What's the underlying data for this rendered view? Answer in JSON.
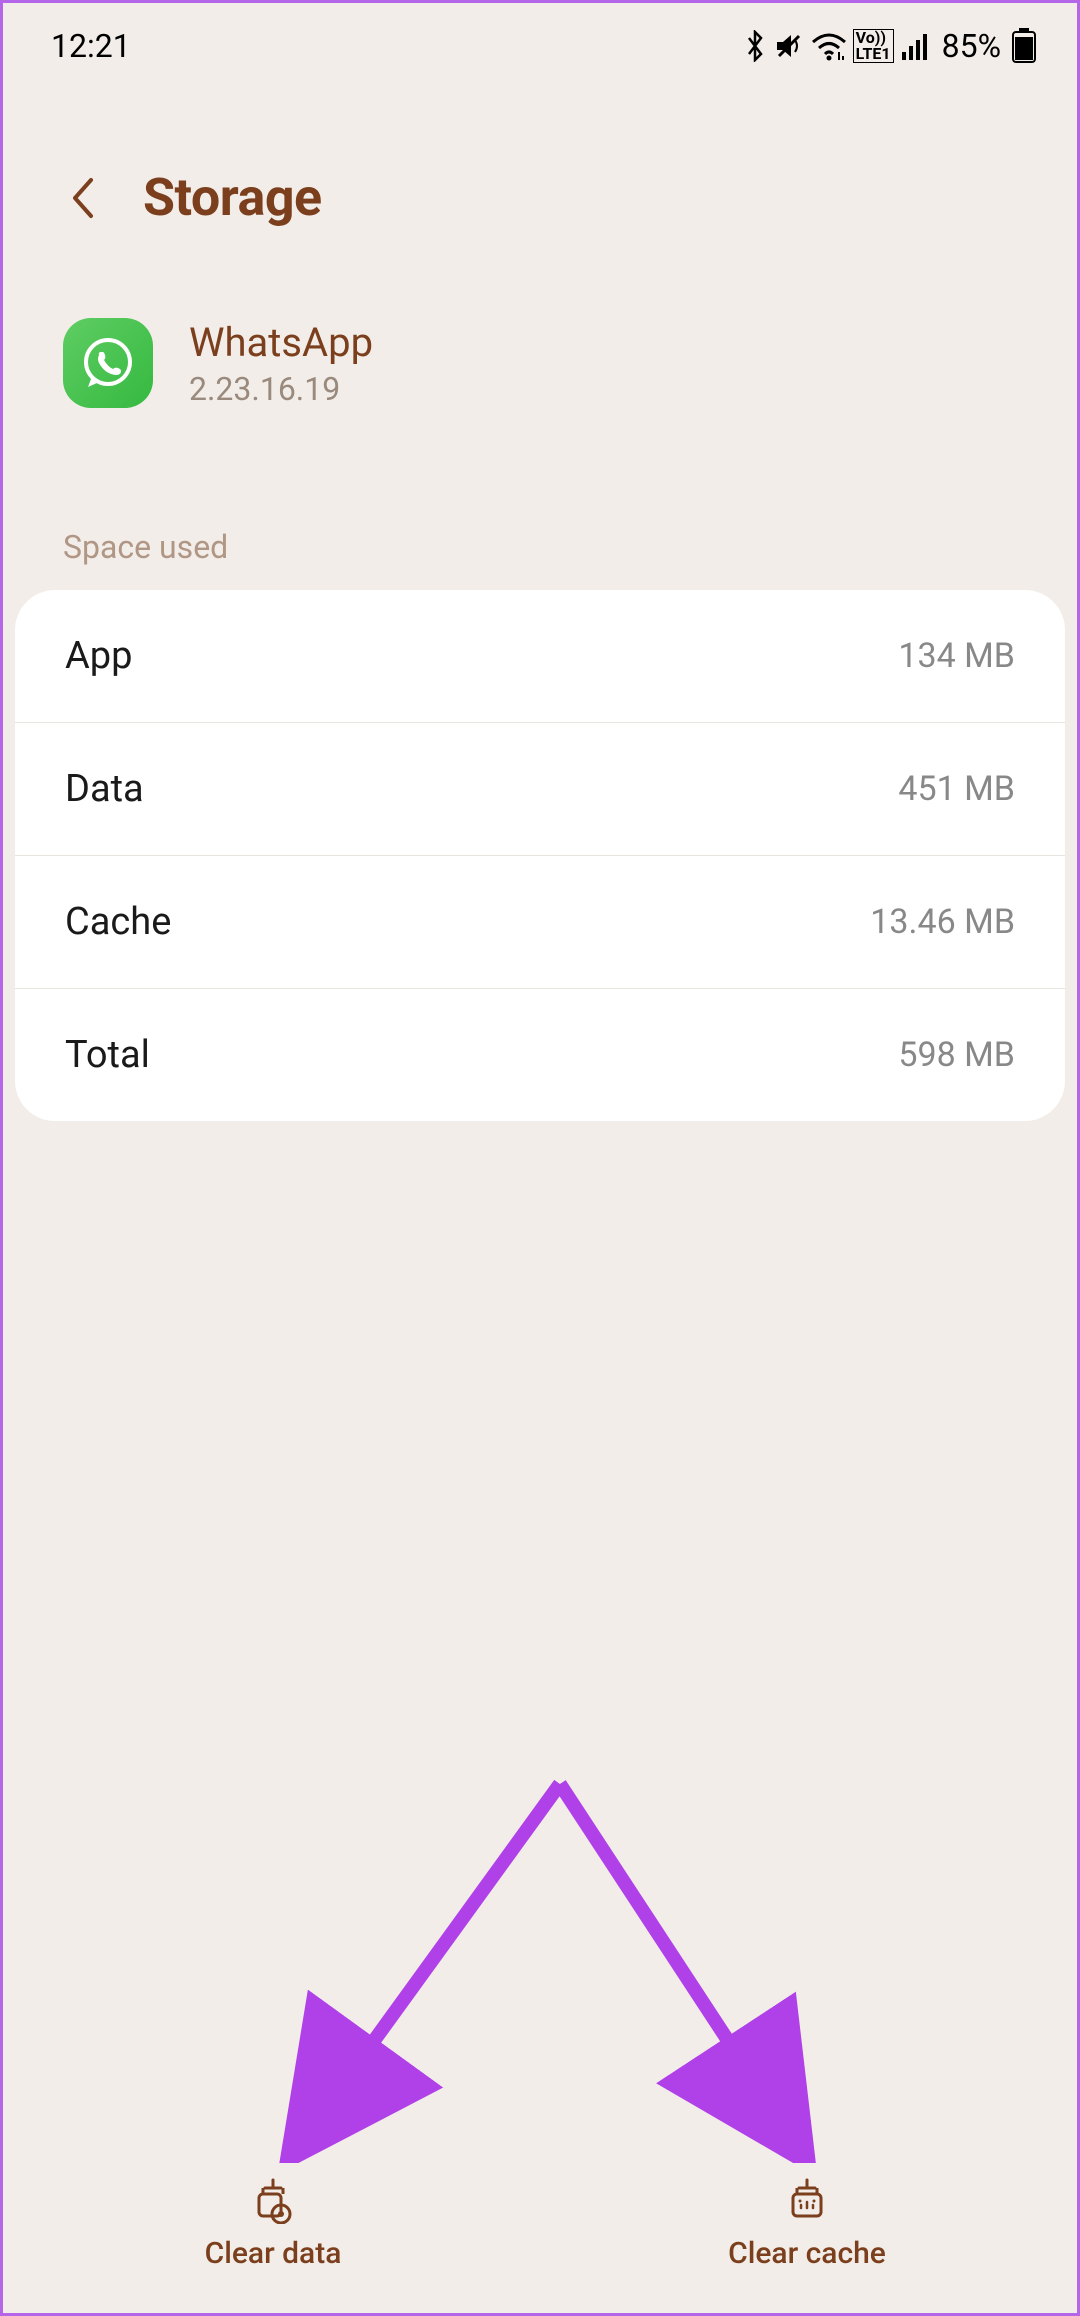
{
  "status_bar": {
    "time": "12:21",
    "battery": "85%"
  },
  "header": {
    "title": "Storage"
  },
  "app": {
    "name": "WhatsApp",
    "version": "2.23.16.19"
  },
  "section": {
    "space_used_label": "Space used"
  },
  "storage": {
    "rows": [
      {
        "label": "App",
        "value": "134 MB"
      },
      {
        "label": "Data",
        "value": "451 MB"
      },
      {
        "label": "Cache",
        "value": "13.46 MB"
      },
      {
        "label": "Total",
        "value": "598 MB"
      }
    ]
  },
  "bottom": {
    "clear_data": "Clear data",
    "clear_cache": "Clear cache"
  }
}
